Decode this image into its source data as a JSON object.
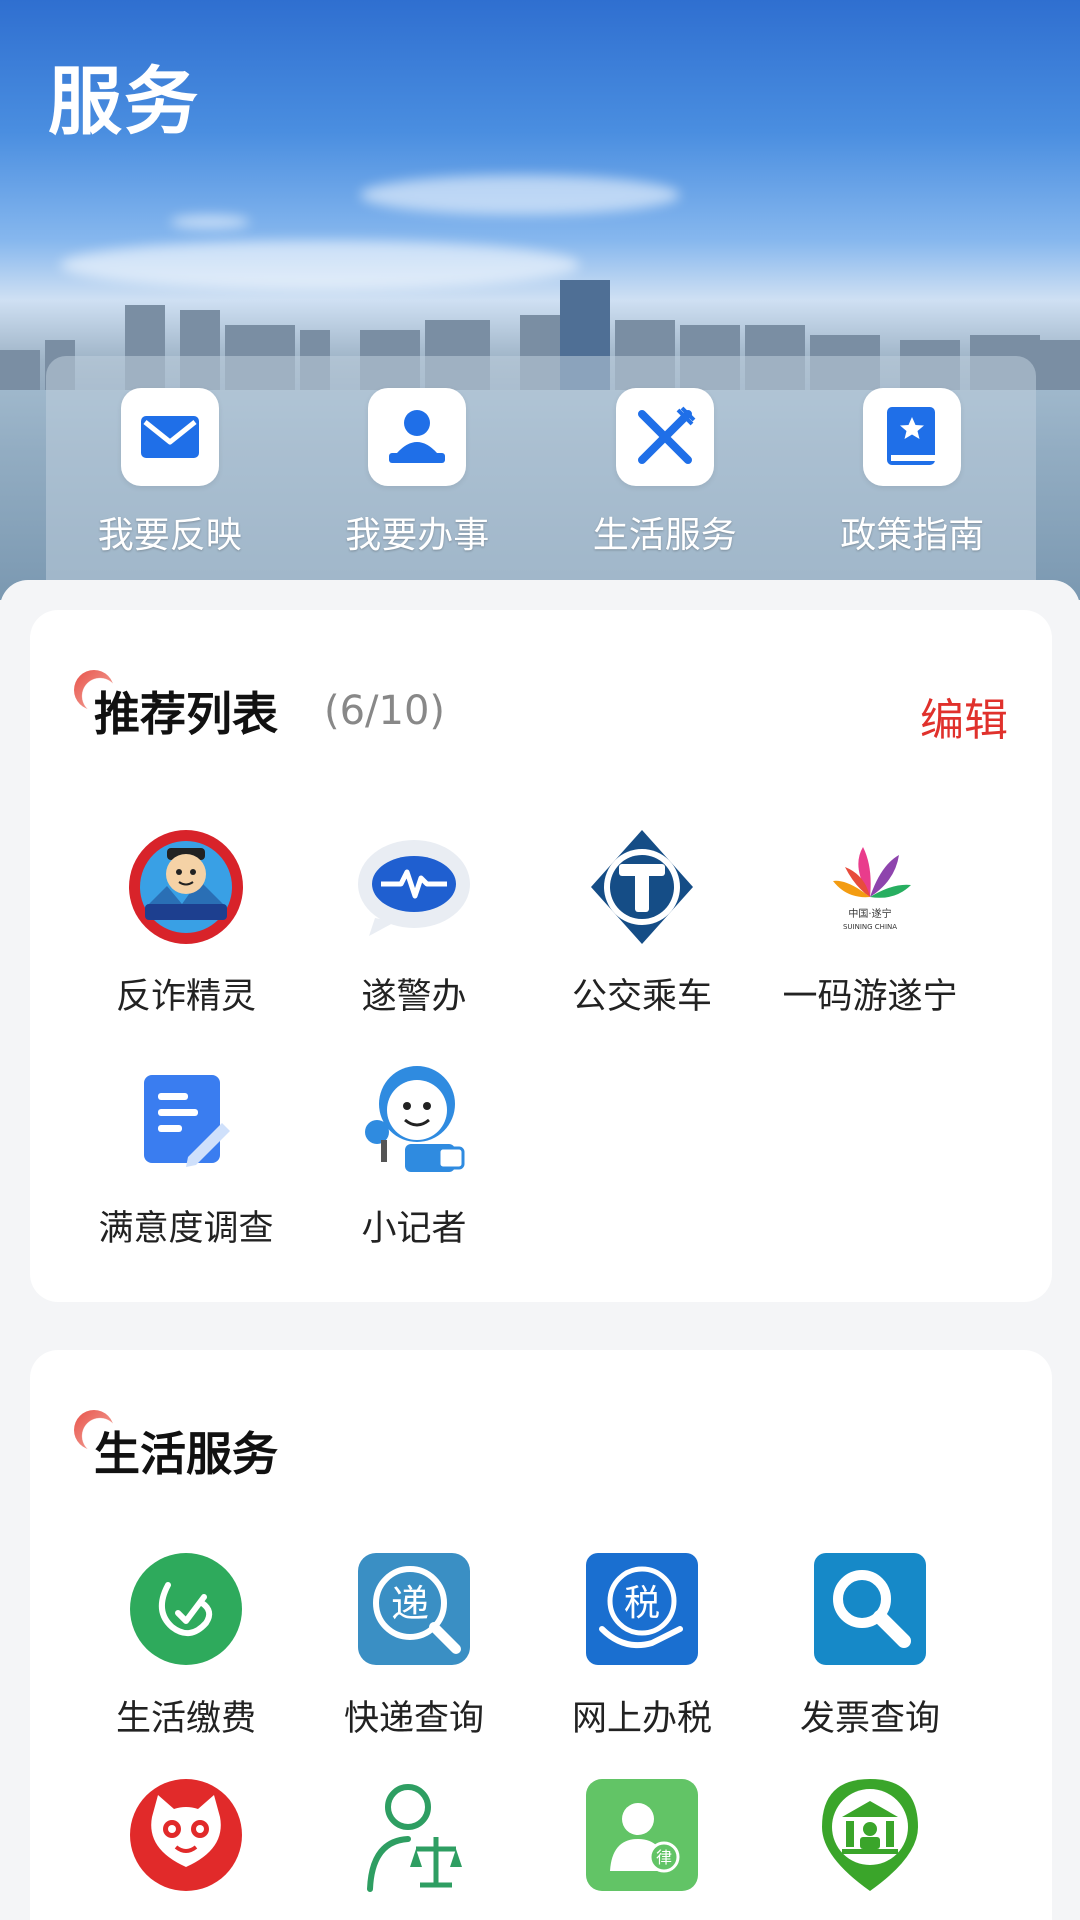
{
  "header": {
    "title": "服务"
  },
  "quick_actions": [
    {
      "label": "我要反映",
      "icon": "mail-icon"
    },
    {
      "label": "我要办事",
      "icon": "person-desk-icon"
    },
    {
      "label": "生活服务",
      "icon": "fork-knife-icon"
    },
    {
      "label": "政策指南",
      "icon": "book-star-icon"
    }
  ],
  "recommend": {
    "title": "推荐列表",
    "count": "(6/10)",
    "edit": "编辑",
    "items": [
      {
        "label": "反诈精灵",
        "icon": "anti-fraud-police-icon"
      },
      {
        "label": "遂警办",
        "icon": "police-pulse-icon"
      },
      {
        "label": "公交乘车",
        "icon": "bus-t-icon"
      },
      {
        "label": "一码游遂宁",
        "icon": "suining-lotus-icon",
        "logo_text": "中国·遂宁 SUINING CHINA"
      },
      {
        "label": "满意度调查",
        "icon": "survey-doc-icon"
      },
      {
        "label": "小记者",
        "icon": "reporter-cartoon-icon"
      }
    ]
  },
  "life": {
    "title": "生活服务",
    "items": [
      {
        "label": "生活缴费",
        "icon": "payment-check-icon"
      },
      {
        "label": "快递查询",
        "icon": "express-search-icon",
        "glyph": "递"
      },
      {
        "label": "网上办税",
        "icon": "tax-hand-icon",
        "glyph": "税"
      },
      {
        "label": "发票查询",
        "icon": "invoice-search-icon"
      },
      {
        "label": "",
        "icon": "cat-face-icon"
      },
      {
        "label": "",
        "icon": "lawyer-scale-icon"
      },
      {
        "label": "",
        "icon": "legal-person-icon",
        "glyph": "律"
      },
      {
        "label": "",
        "icon": "court-pin-icon"
      }
    ]
  },
  "colors": {
    "accent": "#e0312c",
    "blue": "#1f6fe8",
    "text": "#222222"
  }
}
